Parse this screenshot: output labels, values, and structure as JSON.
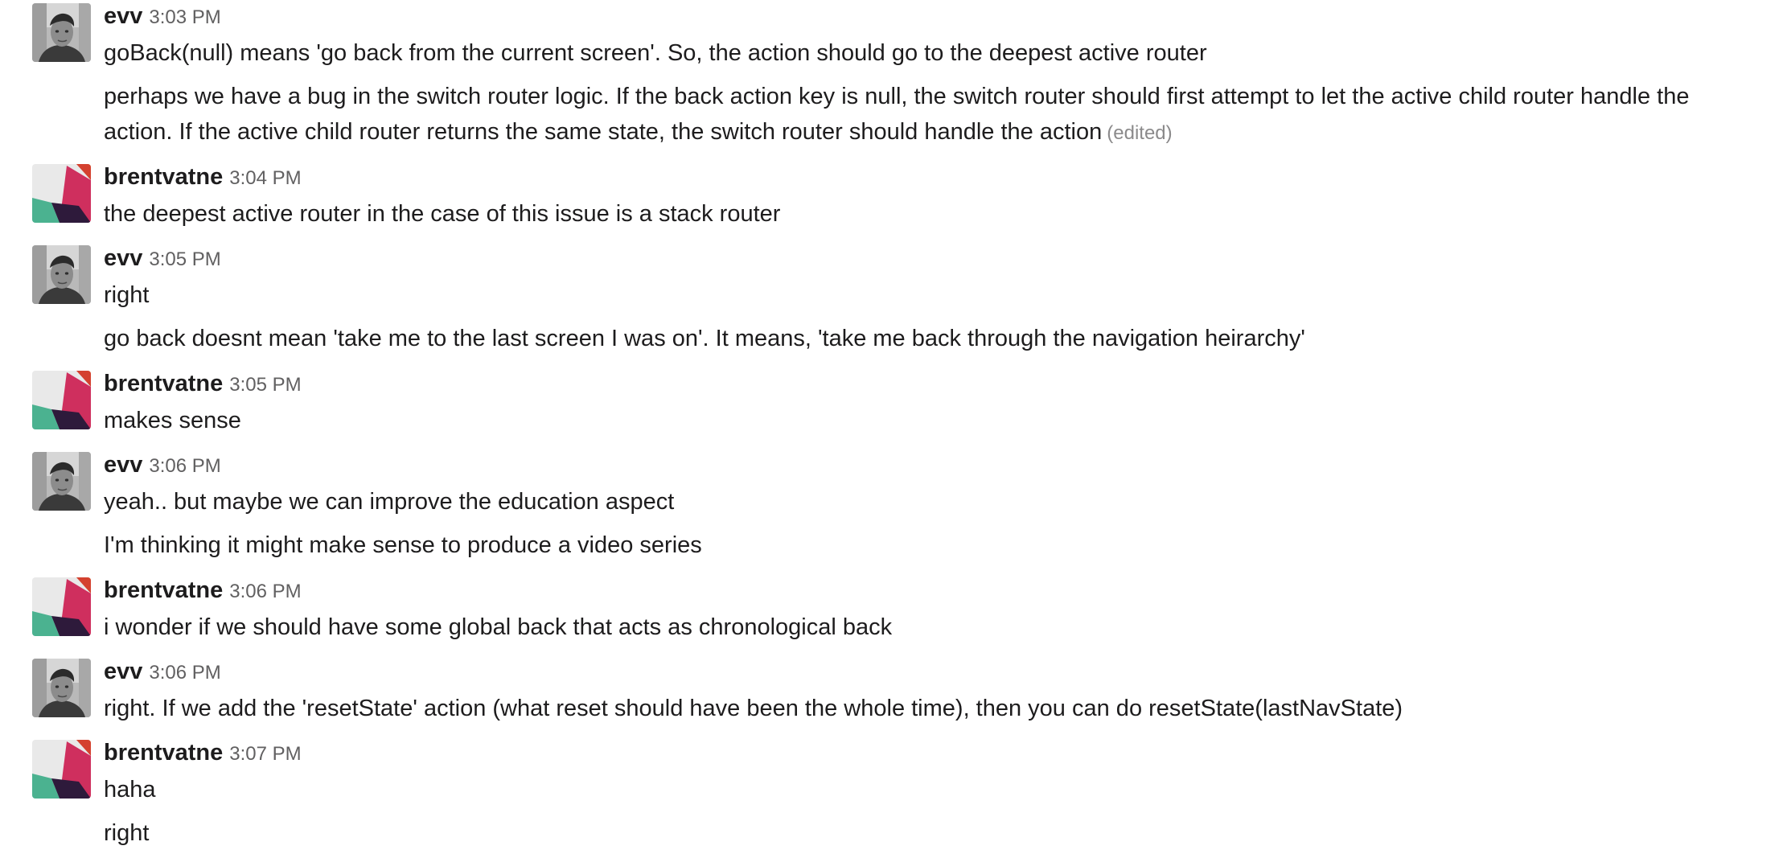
{
  "messages": [
    {
      "author": "evv",
      "time": "3:03 PM",
      "avatar": "evv-photo-avatar",
      "lines": [
        "goBack(null) means 'go back from the current screen'. So, the action should go to the deepest active router",
        "perhaps we have a bug in the switch router logic. If the back action key is null, the switch router should first attempt to let the active child router handle the",
        "action. If the active child router returns the same state, the switch router should handle the action"
      ],
      "edited_label": "(edited)"
    },
    {
      "author": "brentvatne",
      "time": "3:04 PM",
      "avatar": "brentvatne-geometric-avatar",
      "lines": [
        "the deepest active router in the case of this issue is a stack router"
      ]
    },
    {
      "author": "evv",
      "time": "3:05 PM",
      "avatar": "evv-photo-avatar",
      "lines": [
        "right",
        "go back doesnt mean 'take me to the last screen I was on'. It means, 'take me back through the navigation heirarchy'"
      ]
    },
    {
      "author": "brentvatne",
      "time": "3:05 PM",
      "avatar": "brentvatne-geometric-avatar",
      "lines": [
        "makes sense"
      ]
    },
    {
      "author": "evv",
      "time": "3:06 PM",
      "avatar": "evv-photo-avatar",
      "lines": [
        "yeah.. but maybe we can improve the education aspect",
        "I'm thinking it might make sense to produce a video series"
      ]
    },
    {
      "author": "brentvatne",
      "time": "3:06 PM",
      "avatar": "brentvatne-geometric-avatar",
      "lines": [
        "i wonder if we should have some global back that acts as chronological back"
      ]
    },
    {
      "author": "evv",
      "time": "3:06 PM",
      "avatar": "evv-photo-avatar",
      "lines": [
        "right. If we add the 'resetState' action (what reset should have been the whole time), then you can do resetState(lastNavState)"
      ]
    },
    {
      "author": "brentvatne",
      "time": "3:07 PM",
      "avatar": "brentvatne-geometric-avatar",
      "lines": [
        "haha",
        "right"
      ]
    }
  ],
  "colors": {
    "text": "#1d1c1d",
    "timestamp": "#616061",
    "edited": "#8b8a8b",
    "background": "#ffffff"
  }
}
